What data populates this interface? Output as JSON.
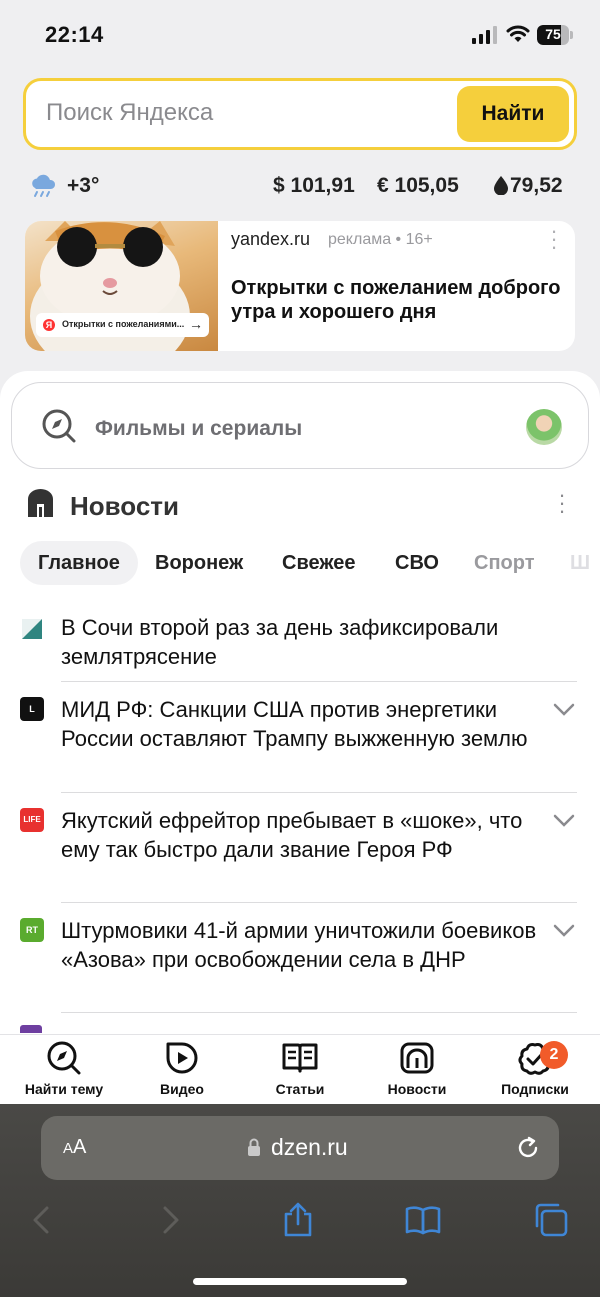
{
  "status_bar": {
    "time": "22:14",
    "battery": "75",
    "battery_level": 0.75
  },
  "search": {
    "placeholder": "Поиск Яндекса",
    "button_label": "Найти"
  },
  "info": {
    "temperature": "+3°",
    "usd": "$ 101,91",
    "eur": "€ 105,05",
    "oil": "79,52"
  },
  "ad": {
    "domain": "yandex.ru",
    "meta": "реклама • 16+",
    "title": "Открытки с пожеланием доброго утра и хорошего дня",
    "chip_text": "Открытки с пожеланиями..."
  },
  "films": {
    "label": "Фильмы и сериалы"
  },
  "news": {
    "title": "Новости",
    "tabs": [
      "Главное",
      "Воронеж",
      "Свежее",
      "СВО",
      "Спорт",
      "Ш"
    ],
    "items": [
      {
        "source_badge": "",
        "source_color": "#3a8a8a",
        "headline": "В Сочи второй раз за день зафиксировали землятрясение",
        "expandable": false
      },
      {
        "source_badge": "L",
        "source_color": "#111111",
        "headline": "МИД РФ: Санкции США против энергетики России оставляют Трампу выжженную землю",
        "expandable": true
      },
      {
        "source_badge": "LIFE",
        "source_color": "#e8312f",
        "headline": "Якутский ефрейтор пребывает в «шоке», что ему так быстро дали звание Героя РФ",
        "expandable": true
      },
      {
        "source_badge": "RT",
        "source_color": "#5aab2e",
        "headline": "Штурмовики 41-й армии уничтожили боевиков «Азова» при освобождении села в ДНР",
        "expandable": true
      }
    ]
  },
  "bottom_nav": {
    "find_topic": "Найти тему",
    "video": "Видео",
    "articles": "Статьи",
    "news": "Новости",
    "subscriptions": "Подписки",
    "subscriptions_badge": "2"
  },
  "browser": {
    "text_size": "AA",
    "url": "dzen.ru"
  },
  "colors": {
    "accent_yellow": "#f5cf3c",
    "badge_orange": "#f15b2a",
    "browser_blue": "#3f86d6"
  }
}
